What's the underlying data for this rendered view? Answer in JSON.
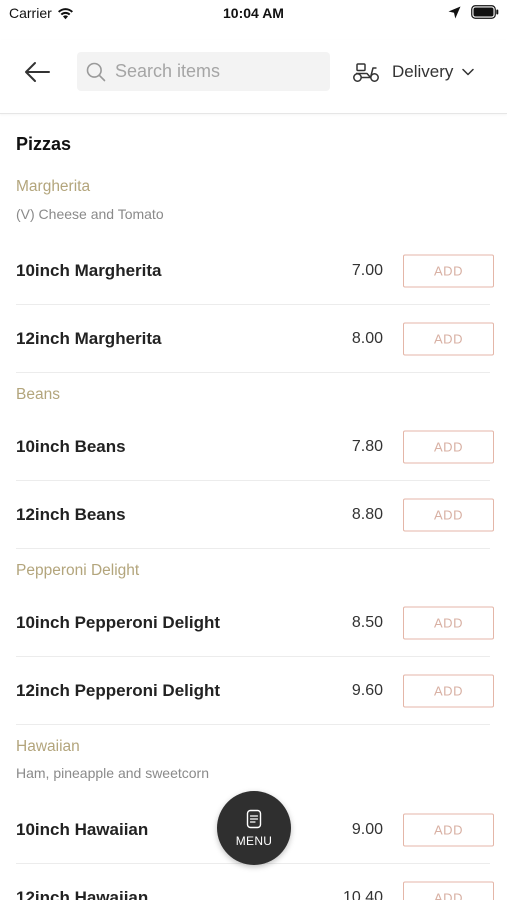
{
  "status_bar": {
    "carrier": "Carrier",
    "time": "10:04 AM",
    "icons": [
      "wifi-icon",
      "location-arrow-icon",
      "battery-icon"
    ]
  },
  "header": {
    "back_icon": "arrow-left-icon",
    "search": {
      "placeholder": "Search items",
      "value": "",
      "icon": "search-icon"
    },
    "delivery": {
      "icon": "scooter-icon",
      "label": "Delivery",
      "chevron": "chevron-down-icon"
    }
  },
  "menu": {
    "section_title": "Pizzas",
    "add_label": "ADD",
    "categories": [
      {
        "name": "Margherita",
        "description": "(V) Cheese and Tomato",
        "items": [
          {
            "name": "10inch Margherita",
            "price": "7.00"
          },
          {
            "name": "12inch Margherita",
            "price": "8.00"
          }
        ]
      },
      {
        "name": "Beans",
        "description": "",
        "items": [
          {
            "name": "10inch Beans",
            "price": "7.80"
          },
          {
            "name": "12inch Beans",
            "price": "8.80"
          }
        ]
      },
      {
        "name": "Pepperoni Delight",
        "description": "",
        "items": [
          {
            "name": "10inch Pepperoni Delight",
            "price": "8.50"
          },
          {
            "name": "12inch Pepperoni Delight",
            "price": "9.60"
          }
        ]
      },
      {
        "name": "Hawaiian",
        "description": "Ham, pineapple and sweetcorn",
        "items": [
          {
            "name": "10inch Hawaiian",
            "price": "9.00"
          },
          {
            "name": "12inch Hawaiian",
            "price": "10.40"
          }
        ]
      }
    ]
  },
  "fab": {
    "label": "MENU",
    "icon": "menu-card-icon"
  },
  "colors": {
    "category": "#b3a57c",
    "add_border": "#e4b6a8",
    "add_text": "#d8b0a3",
    "fab_bg": "#2f2f2f"
  }
}
